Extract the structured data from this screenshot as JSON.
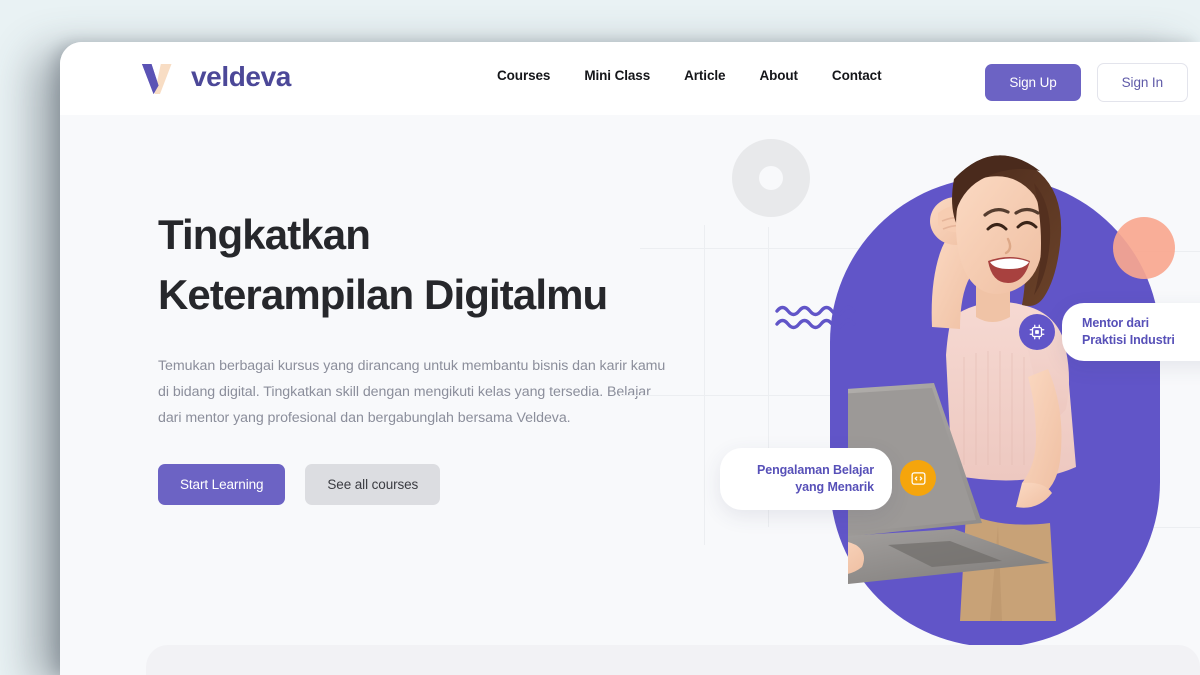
{
  "page": {
    "background_color": "#e9f2f4",
    "card_background": "#ffffff",
    "hero_background": "#f8f9fb"
  },
  "brand": {
    "name": "veldeva",
    "logo_icon": "veldeva-v-logo",
    "logo_primary_color": "#5b53b5",
    "logo_accent_color": "#f8ddc4"
  },
  "nav": {
    "links": [
      {
        "label": "Courses"
      },
      {
        "label": "Mini Class"
      },
      {
        "label": "Article"
      },
      {
        "label": "About"
      },
      {
        "label": "Contact"
      }
    ],
    "sign_up_label": "Sign Up",
    "sign_in_label": "Sign In",
    "sign_up_color": "#6c63c4",
    "sign_in_color": "#5f5aa8"
  },
  "hero": {
    "title_line1": "Tingkatkan",
    "title_line2": "Keterampilan Digitalmu",
    "description": "Temukan berbagai kursus yang dirancang untuk membantu bisnis dan karir kamu di bidang digital. Tingkatkan skill dengan mengikuti kelas yang tersedia. Belajar dari mentor yang profesional dan bergabunglah bersama Veldeva.",
    "primary_button": "Start Learning",
    "secondary_button": "See all courses",
    "primary_button_color": "#6c63c4",
    "secondary_button_color": "#dcdde1"
  },
  "hero_visual": {
    "blob_color": "#6155c8",
    "peach_circle_color": "#f9a78f",
    "ring_color": "#e8e9eb",
    "wave_color": "#6155c8",
    "photo_alt": "smiling-woman-holding-laptop",
    "badges": [
      {
        "id": "mentor",
        "line1": "Mentor dari",
        "line2": "Praktisi Industri",
        "icon": "chip-icon",
        "bubble_color": "#6155c8",
        "text_color": "#5750b8"
      },
      {
        "id": "experience",
        "line1": "Pengalaman Belajar",
        "line2": "yang Menarik",
        "icon": "code-window-icon",
        "bubble_color": "#f5a50c",
        "text_color": "#5750b8"
      }
    ]
  },
  "bottom_section": {
    "background_color": "#f2f2f5"
  }
}
